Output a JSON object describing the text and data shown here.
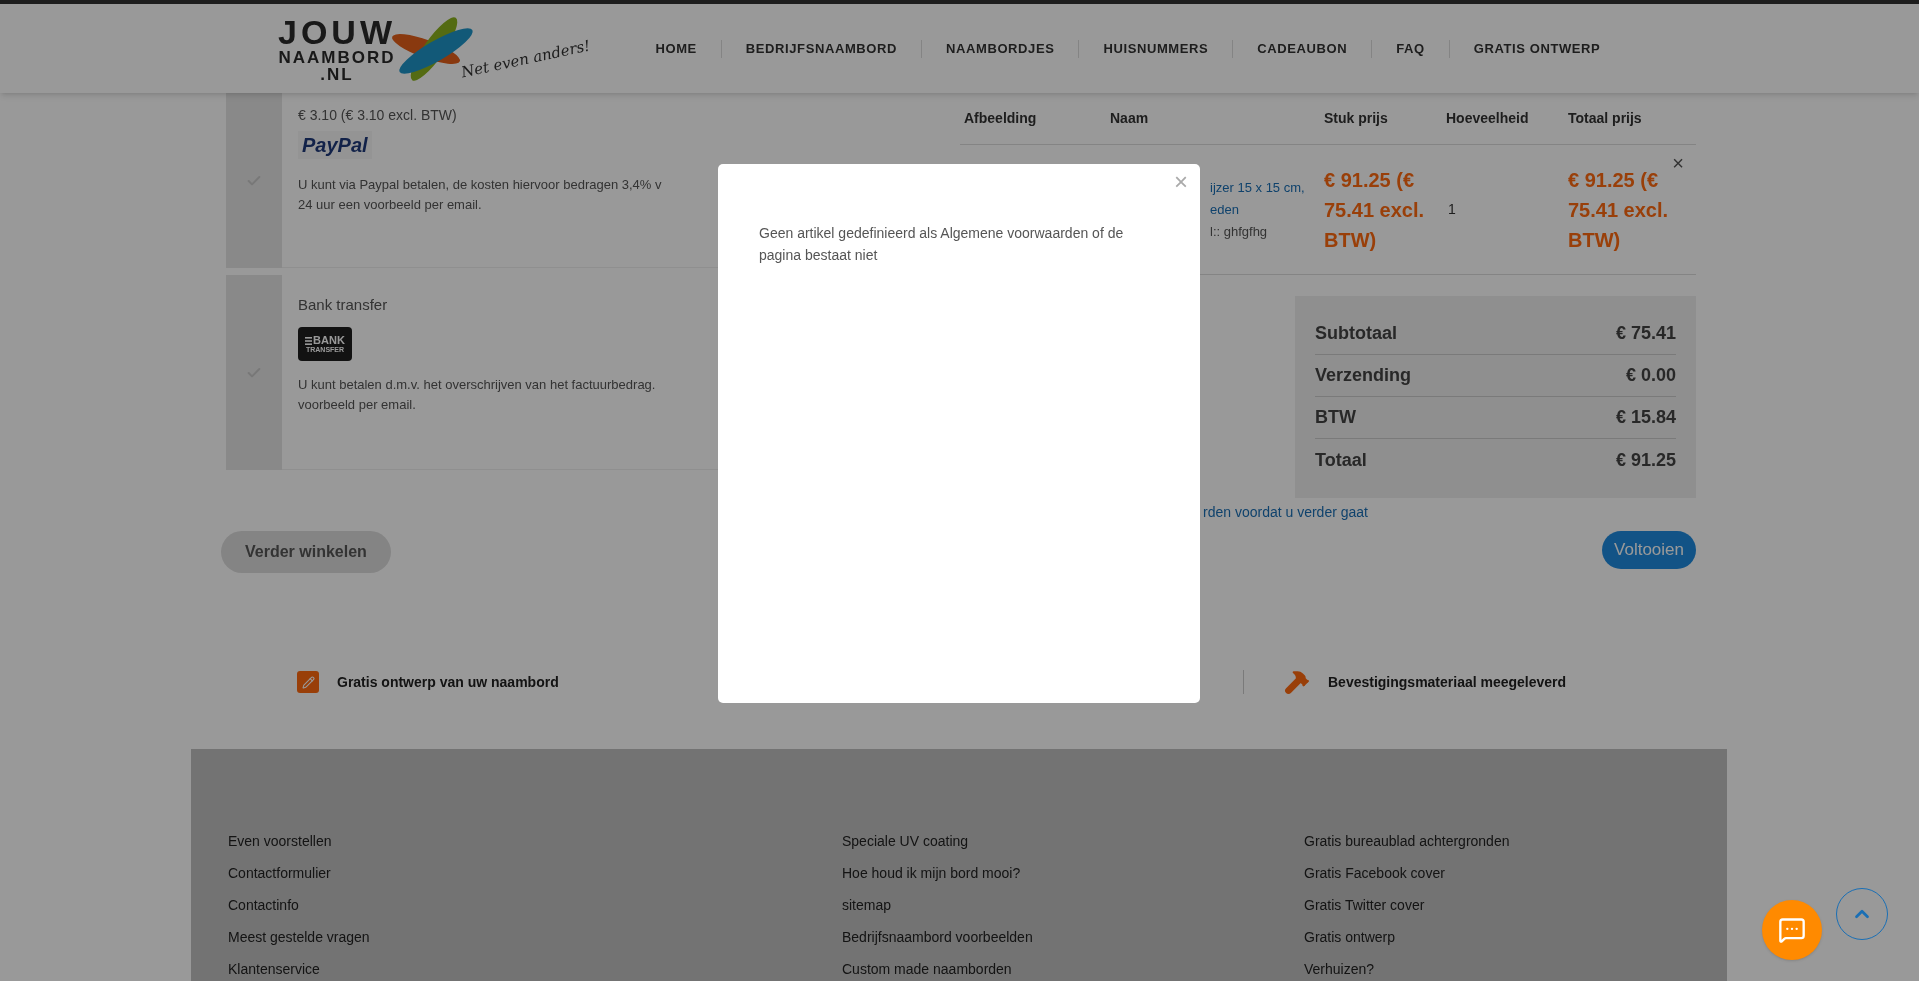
{
  "header": {
    "logo": {
      "line1": "JOUW",
      "line2": "NAAMBORD",
      "line3": ".NL",
      "tagline": "Net even anders!"
    },
    "nav": [
      {
        "label": "HOME"
      },
      {
        "label": "BEDRIJFSNAAMBORD"
      },
      {
        "label": "NAAMBORDJES"
      },
      {
        "label": "HUISNUMMERS"
      },
      {
        "label": "CADEAUBON"
      },
      {
        "label": "FAQ"
      },
      {
        "label": "GRATIS ONTWERP"
      }
    ]
  },
  "payment_methods": [
    {
      "kind": "paypal",
      "selected": false,
      "price": "€ 3.10 (€ 3.10 excl. BTW)",
      "logo": "PayPal",
      "description_lines": [
        "U kunt via Paypal betalen, de kosten hiervoor bedragen 3,4% v",
        "24 uur een voorbeeld per email."
      ]
    },
    {
      "kind": "bank",
      "selected": false,
      "name": "Bank transfer",
      "logo_lines": [
        "BANK",
        "TRANSFER"
      ],
      "description_lines": [
        "U kunt betalen d.m.v. het overschrijven van het factuurbedrag.",
        "voorbeeld per email."
      ]
    }
  ],
  "cart": {
    "columns": [
      "Afbeelding",
      "Naam",
      "Stuk prijs",
      "Hoeveelheid",
      "Totaal prijs"
    ],
    "rows": [
      {
        "name_lines": [
          "ijzer 15 x 15 cm,",
          "eden"
        ],
        "option": "l:: ghfgfhg",
        "unit_price": "€ 91.25 (€ 75.41 excl. BTW)",
        "quantity": "1",
        "total_price": "€ 91.25 (€ 75.41 excl. BTW)",
        "remove": "×"
      }
    ],
    "totals": [
      {
        "label": "Subtotaal",
        "value": "€ 75.41"
      },
      {
        "label": "Verzending",
        "value": "€ 0.00"
      },
      {
        "label": "BTW",
        "value": "€ 15.84"
      },
      {
        "label": "Totaal",
        "value": "€ 91.25"
      }
    ],
    "terms_link": "rden voordat u verder gaat"
  },
  "buttons": {
    "continue": "Verder winkelen",
    "finish": "Voltooien"
  },
  "features": [
    {
      "kind": "pencil",
      "text": "Gratis ontwerp van uw naambord"
    },
    {
      "kind": "hammer",
      "text": "Bevestigingsmateriaal meegeleverd"
    }
  ],
  "footer": {
    "columns": [
      [
        "Even voorstellen",
        "Contactformulier",
        "Contactinfo",
        "Meest gestelde vragen",
        "Klantenservice"
      ],
      [
        "Speciale UV coating",
        "Hoe houd ik mijn bord mooi?",
        "sitemap",
        "Bedrijfsnaambord voorbeelden",
        "Custom made naamborden"
      ],
      [
        "Gratis bureaublad achtergronden",
        "Gratis Facebook cover",
        "Gratis Twitter cover",
        "Gratis ontwerp",
        "Verhuizen?"
      ]
    ]
  },
  "modal": {
    "message": "Geen artikel gedefinieerd als Algemene voorwaarden of de pagina bestaat niet",
    "close": "×"
  }
}
